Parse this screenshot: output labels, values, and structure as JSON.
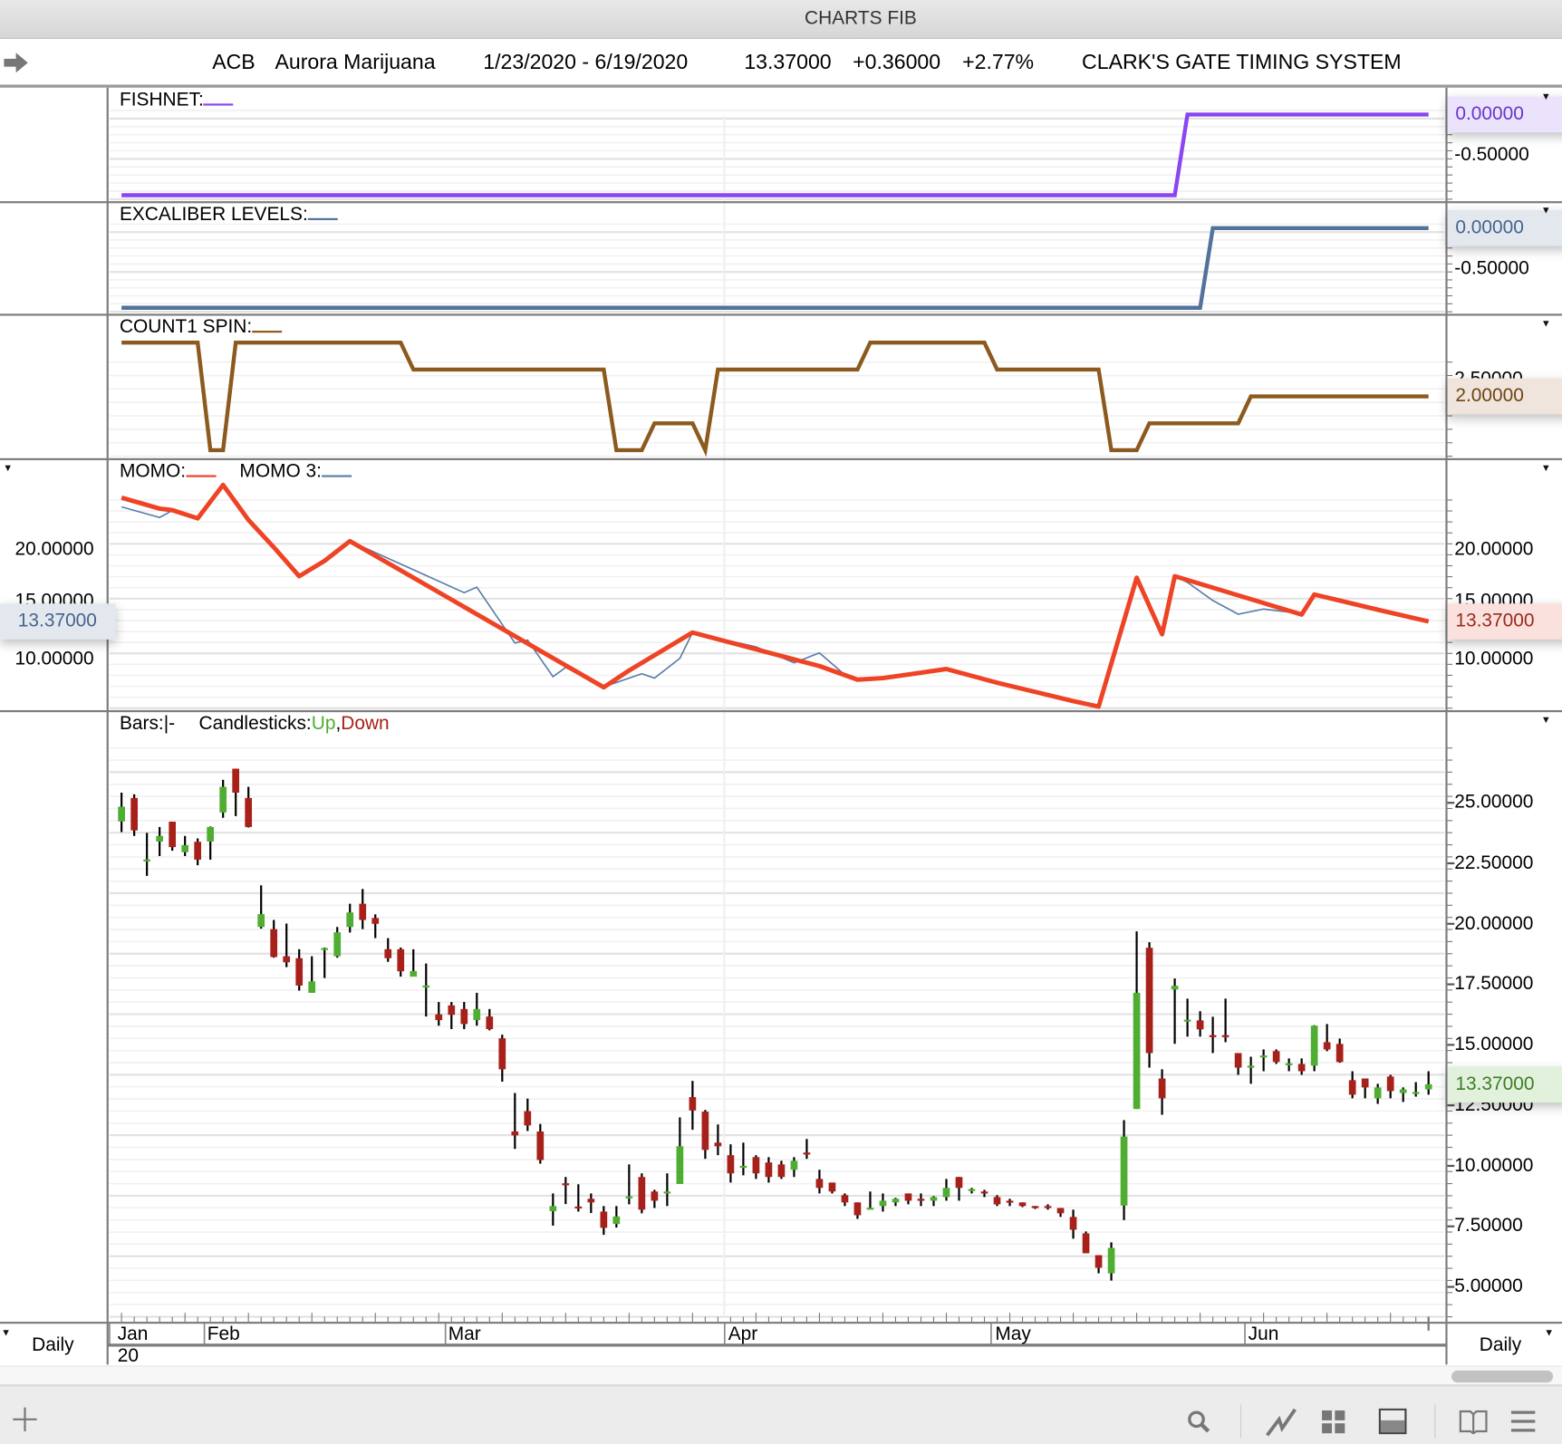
{
  "window": {
    "title": "CHARTS FIB"
  },
  "info": {
    "symbol": "ACB",
    "name": "Aurora Marijuana",
    "date_range": "1/23/2020 - 6/19/2020",
    "last": "13.37000",
    "change": "+0.36000",
    "pct_change": "+2.77%",
    "system": "CLARK'S GATE TIMING SYSTEM"
  },
  "panels": {
    "fishnet": {
      "label": "FISHNET:",
      "color": "#8a46f0",
      "ticks": [
        "0.00000",
        "-0.50000"
      ],
      "current": "0.00000"
    },
    "excaliber": {
      "label": "EXCALIBER LEVELS:",
      "color": "#52729c",
      "ticks": [
        "0.00000",
        "-0.50000"
      ],
      "current": "0.00000"
    },
    "spin": {
      "label": "COUNT1 SPIN:",
      "color": "#8c5a1e",
      "hidden_tick": "2.50000",
      "current": "2.00000"
    },
    "momo": {
      "label": "MOMO:",
      "label2": "MOMO 3:",
      "color": "#ee4325",
      "color2": "#5a7eaa",
      "ticks": [
        "20.00000",
        "15.00000",
        "10.00000"
      ],
      "current_left": "13.37000",
      "current_right": "13.37000"
    },
    "price": {
      "bars_label": "Bars:",
      "bars_glyph": "|-",
      "candles_label": "Candlesticks:",
      "up": "Up",
      "sep": ",",
      "down": "Down",
      "up_color": "#4fae32",
      "down_color": "#a8201a",
      "ticks": [
        "25.00000",
        "22.50000",
        "20.00000",
        "17.50000",
        "15.00000",
        "12.50000",
        "10.00000",
        "7.50000",
        "5.00000"
      ],
      "current": "13.37000"
    }
  },
  "xaxis": {
    "months": [
      "Jan",
      "Feb",
      "Mar",
      "Apr",
      "May",
      "Jun"
    ],
    "year": "20",
    "left_period": "Daily",
    "right_period": "Daily"
  },
  "toolbar": {
    "icons": [
      "plus-icon",
      "search-icon",
      "line-chart-icon",
      "grid-icon",
      "panel-icon",
      "book-icon",
      "menu-icon"
    ]
  },
  "chart_data": {
    "type": "candlestick",
    "title": "ACB Aurora Marijuana",
    "x_start": "1/23/2020",
    "x_end": "6/19/2020",
    "month_start_index": {
      "Jan": 0,
      "Feb": 7,
      "Mar": 26,
      "Apr": 48,
      "May": 69,
      "Jun": 89
    },
    "price_ylim": [
      4.2,
      27.8
    ],
    "ohlc": [
      [
        24.23,
        25.42,
        23.79,
        24.84
      ],
      [
        25.2,
        25.35,
        23.63,
        23.86
      ],
      [
        22.58,
        23.76,
        21.98,
        22.66
      ],
      [
        23.4,
        24.0,
        22.8,
        23.63
      ],
      [
        24.22,
        24.22,
        23.02,
        23.17
      ],
      [
        22.96,
        23.63,
        22.8,
        23.25
      ],
      [
        23.39,
        23.53,
        22.42,
        22.65
      ],
      [
        23.4,
        24.02,
        22.65,
        24.0
      ],
      [
        24.6,
        25.95,
        24.38,
        25.66
      ],
      [
        26.41,
        26.41,
        24.45,
        25.42
      ],
      [
        25.2,
        25.66,
        23.98,
        24.0
      ],
      [
        19.87,
        21.59,
        19.8,
        20.4
      ],
      [
        19.78,
        20.16,
        18.6,
        18.63
      ],
      [
        18.66,
        20.01,
        18.21,
        18.41
      ],
      [
        18.58,
        18.95,
        17.24,
        17.45
      ],
      [
        17.15,
        18.66,
        17.15,
        17.62
      ],
      [
        18.95,
        19.02,
        17.76,
        19.0
      ],
      [
        18.66,
        19.87,
        18.6,
        19.65
      ],
      [
        19.87,
        20.83,
        19.64,
        20.47
      ],
      [
        20.83,
        21.44,
        19.78,
        20.16
      ],
      [
        20.24,
        20.39,
        19.41,
        20.0
      ],
      [
        18.95,
        19.41,
        18.43,
        18.58
      ],
      [
        18.95,
        19.02,
        17.82,
        18.04
      ],
      [
        17.82,
        18.95,
        17.82,
        18.05
      ],
      [
        17.4,
        18.36,
        16.17,
        17.45
      ],
      [
        16.26,
        16.77,
        15.79,
        16.02
      ],
      [
        16.63,
        16.77,
        15.65,
        16.24
      ],
      [
        16.48,
        16.77,
        15.65,
        15.86
      ],
      [
        16.02,
        17.15,
        15.79,
        16.48
      ],
      [
        16.17,
        16.48,
        15.6,
        15.65
      ],
      [
        15.27,
        15.42,
        13.48,
        13.99
      ],
      [
        11.42,
        13.01,
        10.7,
        11.26
      ],
      [
        12.26,
        12.78,
        11.44,
        11.67
      ],
      [
        11.42,
        11.73,
        10.09,
        10.24
      ],
      [
        8.13,
        8.86,
        7.53,
        8.34
      ],
      [
        9.28,
        9.54,
        8.42,
        9.24
      ],
      [
        8.32,
        9.24,
        8.11,
        8.28
      ],
      [
        8.64,
        8.86,
        8.05,
        8.49
      ],
      [
        8.11,
        8.34,
        7.15,
        7.44
      ],
      [
        7.6,
        8.34,
        7.45,
        7.91
      ],
      [
        8.68,
        10.06,
        8.41,
        8.74
      ],
      [
        9.54,
        9.69,
        8.04,
        8.19
      ],
      [
        8.94,
        9.01,
        8.26,
        8.56
      ],
      [
        8.88,
        9.69,
        8.34,
        8.94
      ],
      [
        9.25,
        12.0,
        9.25,
        10.81
      ],
      [
        12.84,
        13.51,
        11.49,
        12.29
      ],
      [
        12.24,
        12.31,
        10.29,
        10.66
      ],
      [
        10.96,
        11.71,
        10.44,
        10.81
      ],
      [
        10.44,
        10.89,
        9.31,
        9.69
      ],
      [
        9.95,
        10.96,
        9.61,
        10.0
      ],
      [
        10.36,
        10.44,
        9.46,
        9.69
      ],
      [
        10.14,
        10.36,
        9.31,
        9.54
      ],
      [
        10.06,
        10.21,
        9.46,
        9.54
      ],
      [
        9.84,
        10.36,
        9.54,
        10.21
      ],
      [
        10.55,
        11.11,
        10.29,
        10.5
      ],
      [
        9.46,
        9.84,
        8.86,
        9.09
      ],
      [
        9.31,
        9.31,
        8.86,
        8.94
      ],
      [
        8.79,
        8.86,
        8.34,
        8.49
      ],
      [
        8.49,
        8.49,
        7.81,
        7.96
      ],
      [
        8.21,
        8.94,
        8.21,
        8.27
      ],
      [
        8.34,
        8.86,
        8.11,
        8.56
      ],
      [
        8.49,
        8.68,
        8.34,
        8.64
      ],
      [
        8.86,
        8.86,
        8.41,
        8.56
      ],
      [
        8.64,
        8.86,
        8.34,
        8.56
      ],
      [
        8.56,
        8.75,
        8.34,
        8.71
      ],
      [
        8.71,
        9.46,
        8.56,
        9.09
      ],
      [
        9.54,
        9.54,
        8.56,
        9.09
      ],
      [
        9.0,
        9.09,
        8.86,
        9.04
      ],
      [
        8.94,
        9.01,
        8.71,
        8.86
      ],
      [
        8.71,
        8.79,
        8.34,
        8.41
      ],
      [
        8.56,
        8.64,
        8.34,
        8.49
      ],
      [
        8.49,
        8.49,
        8.3,
        8.34
      ],
      [
        8.34,
        8.34,
        8.22,
        8.26
      ],
      [
        8.34,
        8.41,
        8.19,
        8.26
      ],
      [
        8.26,
        8.26,
        7.89,
        8.04
      ],
      [
        7.89,
        8.19,
        6.99,
        7.36
      ],
      [
        7.21,
        7.29,
        6.39,
        6.39
      ],
      [
        6.31,
        6.31,
        5.56,
        5.79
      ],
      [
        5.56,
        6.84,
        5.26,
        6.61
      ],
      [
        8.36,
        11.89,
        7.76,
        11.21
      ],
      [
        12.35,
        19.69,
        12.35,
        17.15
      ],
      [
        19.01,
        19.24,
        14.06,
        14.66
      ],
      [
        13.61,
        13.99,
        12.11,
        12.79
      ],
      [
        17.29,
        17.74,
        15.04,
        17.44
      ],
      [
        15.99,
        16.91,
        15.34,
        16.04
      ],
      [
        16.01,
        16.39,
        15.34,
        15.64
      ],
      [
        15.4,
        16.16,
        14.66,
        15.35
      ],
      [
        15.4,
        16.91,
        15.11,
        15.35
      ],
      [
        14.66,
        14.66,
        13.76,
        14.06
      ],
      [
        14.08,
        14.51,
        13.39,
        14.14
      ],
      [
        14.52,
        14.81,
        13.91,
        14.56
      ],
      [
        14.74,
        14.81,
        14.21,
        14.29
      ],
      [
        14.2,
        14.44,
        13.91,
        14.24
      ],
      [
        14.21,
        14.44,
        13.76,
        13.91
      ],
      [
        14.14,
        15.81,
        13.91,
        15.79
      ],
      [
        15.11,
        15.86,
        14.74,
        14.81
      ],
      [
        15.04,
        15.26,
        14.26,
        14.29
      ],
      [
        13.54,
        13.91,
        12.79,
        12.94
      ],
      [
        13.61,
        13.61,
        12.79,
        13.24
      ],
      [
        12.79,
        13.39,
        12.56,
        13.24
      ],
      [
        13.69,
        13.76,
        12.79,
        13.09
      ],
      [
        13.01,
        13.24,
        12.64,
        13.16
      ],
      [
        13.01,
        13.46,
        12.86,
        13.05
      ],
      [
        13.16,
        13.91,
        12.94,
        13.37
      ]
    ],
    "momo": [
      [
        0,
        24.67
      ],
      [
        3,
        23.67
      ],
      [
        4,
        23.53
      ],
      [
        6,
        22.78
      ],
      [
        8,
        25.83
      ],
      [
        10,
        22.64
      ],
      [
        12,
        20.14
      ],
      [
        14,
        17.5
      ],
      [
        16,
        18.9
      ],
      [
        18,
        20.7
      ],
      [
        38,
        7.36
      ],
      [
        40,
        8.9
      ],
      [
        45,
        12.36
      ],
      [
        55,
        9.3
      ],
      [
        58,
        8.06
      ],
      [
        60,
        8.2
      ],
      [
        65,
        9.03
      ],
      [
        69,
        7.78
      ],
      [
        72,
        6.94
      ],
      [
        75,
        6.1
      ],
      [
        77,
        5.6
      ],
      [
        80,
        17.36
      ],
      [
        82,
        12.2
      ],
      [
        83,
        17.5
      ],
      [
        93,
        14.0
      ],
      [
        94,
        15.83
      ],
      [
        97,
        15.0
      ],
      [
        100,
        14.17
      ],
      [
        103,
        13.37
      ]
    ],
    "momo3": [
      [
        0,
        23.83
      ],
      [
        3,
        22.86
      ],
      [
        4,
        23.5
      ],
      [
        6,
        22.78
      ],
      [
        8,
        25.83
      ],
      [
        10,
        22.64
      ],
      [
        12,
        20.14
      ],
      [
        14,
        17.5
      ],
      [
        16,
        18.9
      ],
      [
        18,
        20.7
      ],
      [
        27,
        16.0
      ],
      [
        28,
        16.5
      ],
      [
        31,
        11.4
      ],
      [
        32,
        11.67
      ],
      [
        34,
        8.33
      ],
      [
        35,
        9.17
      ],
      [
        38,
        7.4
      ],
      [
        41,
        8.6
      ],
      [
        42,
        8.2
      ],
      [
        44,
        10.0
      ],
      [
        45,
        12.36
      ],
      [
        50,
        11.05
      ],
      [
        53,
        9.6
      ],
      [
        55,
        10.5
      ],
      [
        57,
        8.5
      ],
      [
        58,
        8.06
      ],
      [
        60,
        8.2
      ],
      [
        65,
        9.03
      ],
      [
        69,
        7.78
      ],
      [
        72,
        6.94
      ],
      [
        75,
        6.1
      ],
      [
        77,
        5.6
      ],
      [
        80,
        17.36
      ],
      [
        82,
        12.2
      ],
      [
        83,
        17.5
      ],
      [
        84,
        16.94
      ],
      [
        86,
        15.28
      ],
      [
        88,
        14.03
      ],
      [
        90,
        14.5
      ],
      [
        92,
        14.22
      ],
      [
        93,
        14.0
      ],
      [
        94,
        15.83
      ],
      [
        97,
        15.0
      ],
      [
        100,
        14.17
      ],
      [
        103,
        13.37
      ]
    ],
    "fishnet": {
      "low": -1,
      "high": 0,
      "step_index": 84
    },
    "excaliber": {
      "low": -1,
      "high": 0,
      "step_index": 86
    },
    "spin_segments": [
      [
        0,
        4
      ],
      [
        6,
        4
      ],
      [
        7,
        0
      ],
      [
        8,
        0
      ],
      [
        9,
        4
      ],
      [
        22,
        4
      ],
      [
        23,
        3
      ],
      [
        38,
        3
      ],
      [
        39,
        0
      ],
      [
        41,
        0
      ],
      [
        42,
        1
      ],
      [
        45,
        1
      ],
      [
        46,
        0
      ],
      [
        47,
        3
      ],
      [
        58,
        3
      ],
      [
        59,
        4
      ],
      [
        68,
        4
      ],
      [
        69,
        3
      ],
      [
        77,
        3
      ],
      [
        78,
        0
      ],
      [
        80,
        0
      ],
      [
        81,
        1
      ],
      [
        88,
        1
      ],
      [
        89,
        2
      ],
      [
        103,
        2
      ]
    ]
  }
}
